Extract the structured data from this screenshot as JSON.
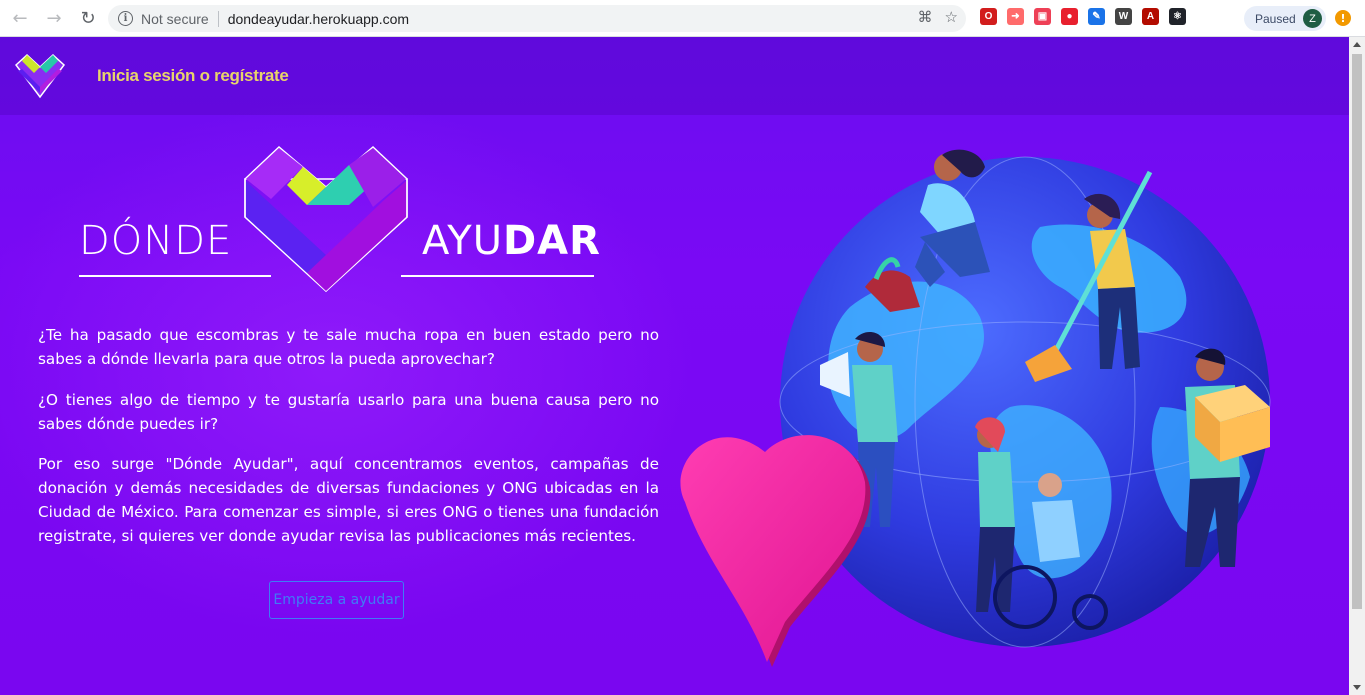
{
  "browser": {
    "back_icon": "arrow-left-icon",
    "forward_icon": "arrow-right-icon",
    "reload_icon": "reload-icon",
    "security_label": "Not secure",
    "url": "dondeayudar.herokuapp.com",
    "profile_status": "Paused",
    "profile_initial": "Z",
    "extensions": [
      {
        "name": "opera-extension-icon",
        "color": "#d21d1d",
        "glyph": "O"
      },
      {
        "name": "arrow-extension-icon",
        "color": "#ff6b6b",
        "glyph": "➜"
      },
      {
        "name": "pocket-extension-icon",
        "color": "#ee4056",
        "glyph": "▣"
      },
      {
        "name": "adblock-extension-icon",
        "color": "#e8202e",
        "glyph": "●"
      },
      {
        "name": "eyedropper-extension-icon",
        "color": "#1a73e8",
        "glyph": "✎"
      },
      {
        "name": "w-extension-icon",
        "color": "#444444",
        "glyph": "W"
      },
      {
        "name": "pdf-extension-icon",
        "color": "#b30b00",
        "glyph": "A"
      },
      {
        "name": "react-extension-icon",
        "color": "#20232a",
        "glyph": "⚛"
      }
    ]
  },
  "header": {
    "login_label": "Inicia sesión o regístrate"
  },
  "brand": {
    "left_word": "DÓNDE",
    "right_word_light": "AYU",
    "right_word_bold": "DAR"
  },
  "intro": {
    "paragraph_1": "¿Te ha pasado que escombras y te sale mucha ropa en buen estado pero no sabes a dónde llevarla para que otros la pueda aprovechar?",
    "paragraph_2": "¿O tienes algo de tiempo y te gustaría usarlo para una buena causa pero no sabes dónde puedes ir?",
    "paragraph_3": "Por eso surge \"Dónde Ayudar\", aquí concentramos eventos, campañas de donación y demás necesidades de diversas fundaciones y ONG ubicadas en la Ciudad de México. Para comenzar es simple, si eres ONG o tienes una fundación registrate, si quieres ver donde ayudar revisa las publicaciones más recientes."
  },
  "cta": {
    "label": "Empieza a ayudar"
  },
  "colors": {
    "background": "#7a09f5",
    "login_accent": "#e8d46a",
    "cta_blue": "#3f7cf5",
    "heart_pink": "#ff2ea8"
  }
}
